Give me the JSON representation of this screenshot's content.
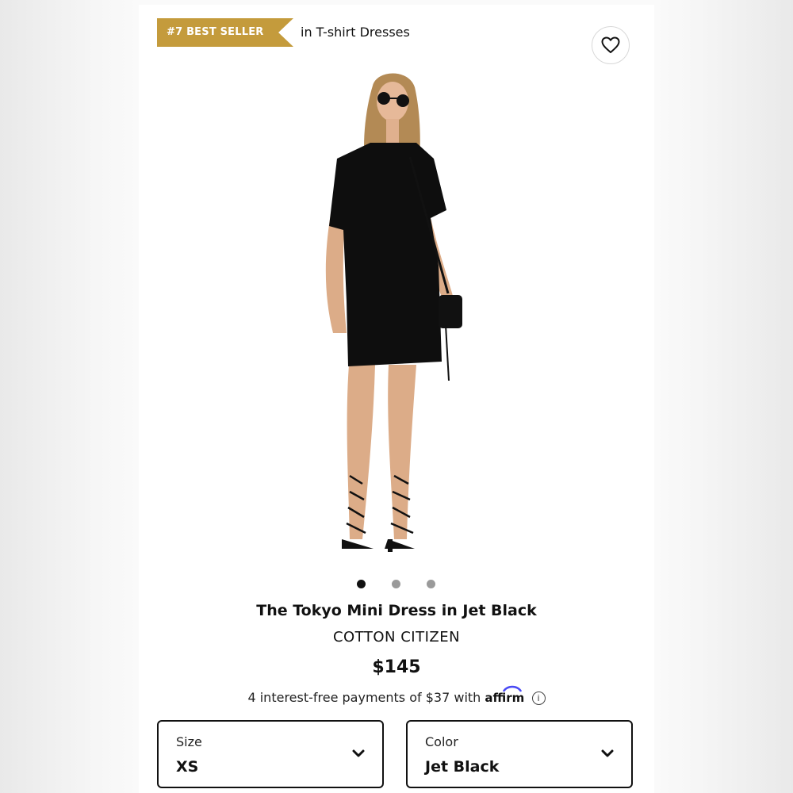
{
  "badge": {
    "label": "#7 BEST SELLER",
    "category": "in T-shirt Dresses",
    "color": "#c49b3c"
  },
  "wishlist": {
    "icon": "heart-icon"
  },
  "carousel": {
    "count": 3,
    "active_index": 0
  },
  "product": {
    "title": "The Tokyo Mini Dress in Jet Black",
    "brand": "COTTON CITIZEN",
    "price": "$145",
    "installments_text": "4 interest-free payments of $37 with",
    "affirm_logo": "affirm",
    "info_icon": "i"
  },
  "size_select": {
    "label": "Size",
    "value": "XS"
  },
  "color_select": {
    "label": "Color",
    "value": "Jet Black"
  }
}
